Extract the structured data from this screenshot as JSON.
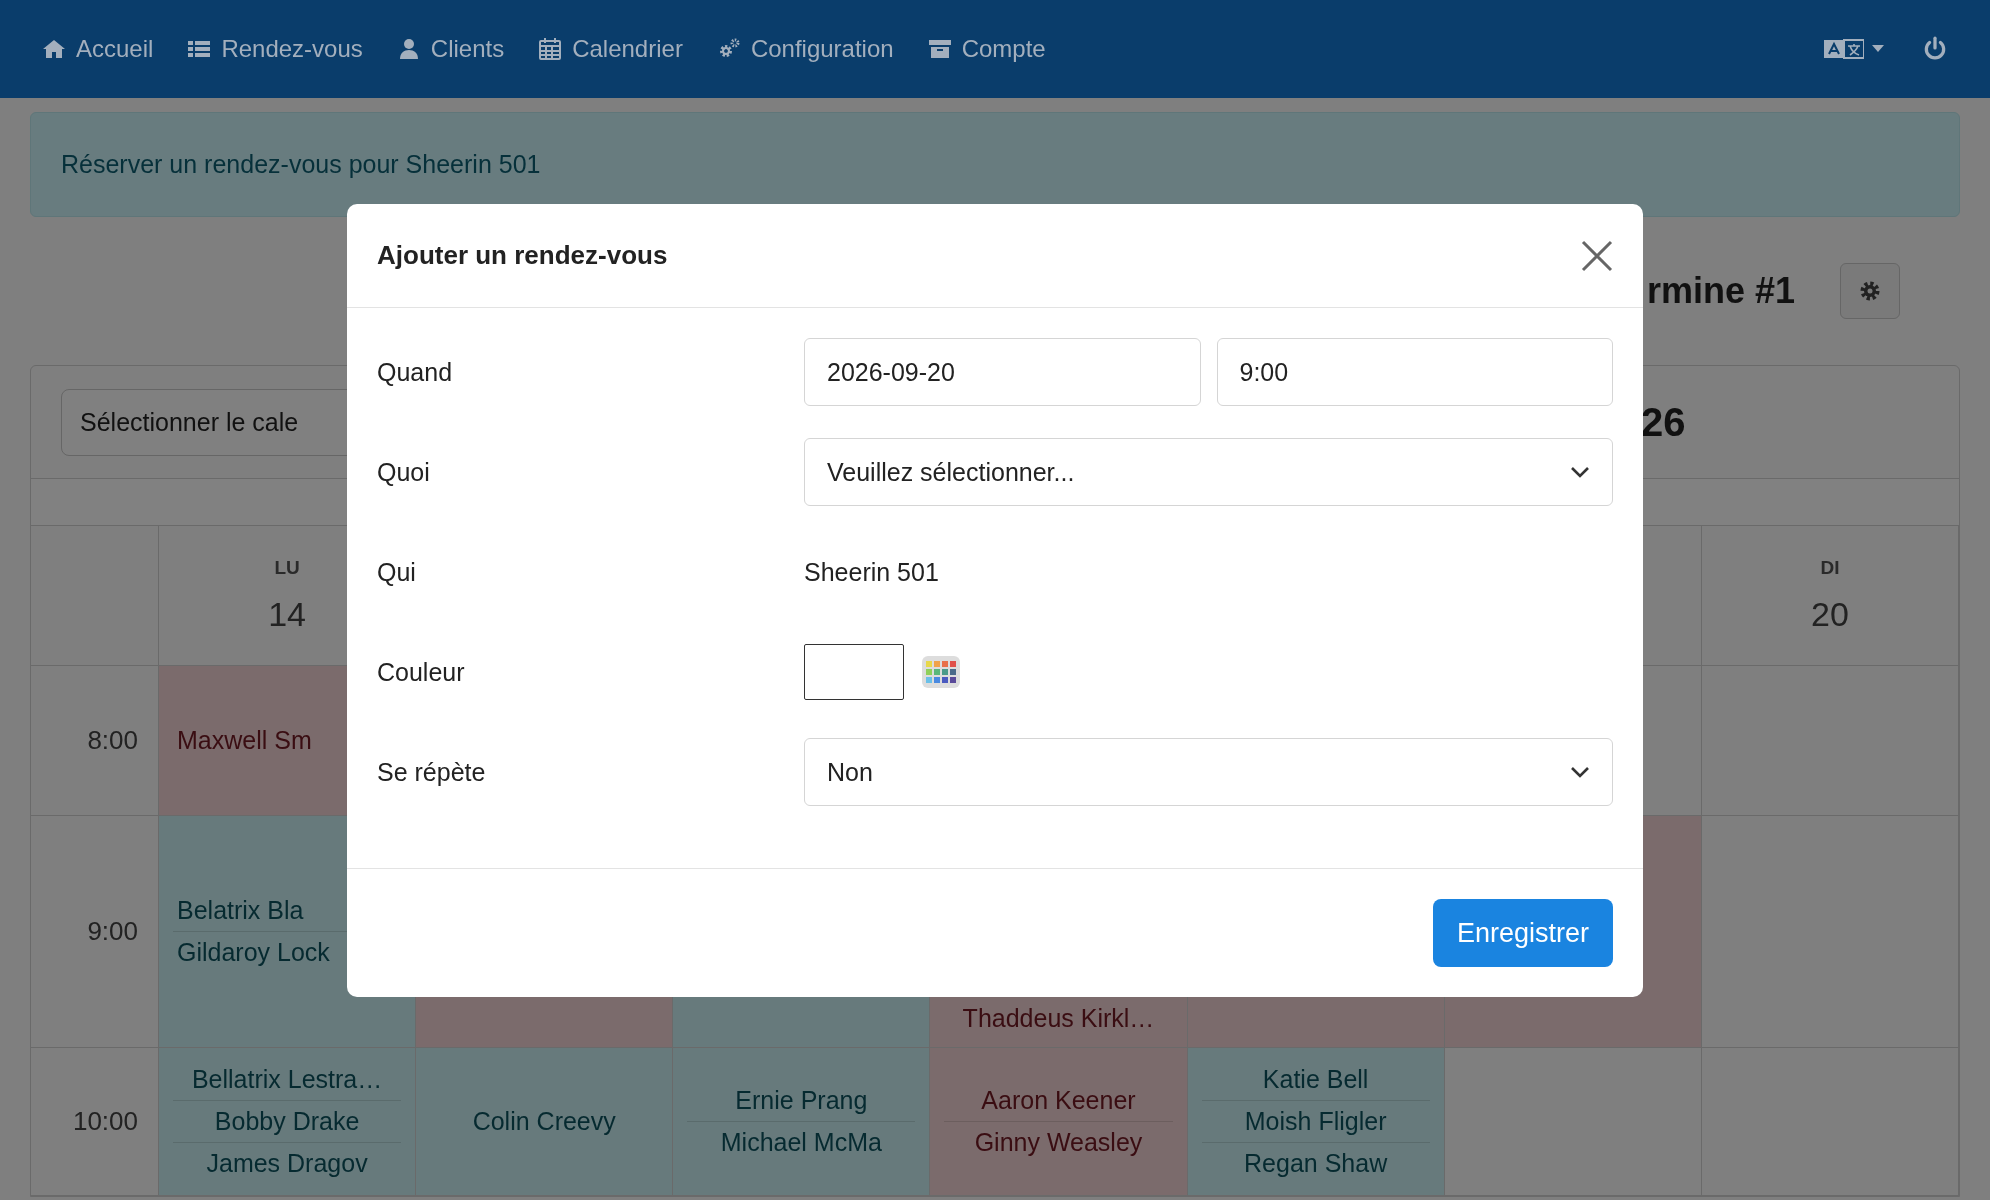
{
  "nav": {
    "items": [
      "Accueil",
      "Rendez-vous",
      "Clients",
      "Calendrier",
      "Configuration",
      "Compte"
    ]
  },
  "alert": {
    "text": "Réserver un rendez-vous pour Sheerin 501"
  },
  "calendar": {
    "heading": "rmine #1",
    "select_button": "Sélectionner le cale",
    "period": "26",
    "days": [
      {
        "abbr": "LU",
        "date": "14"
      },
      {
        "abbr": "DI",
        "date": "20"
      }
    ],
    "rows": [
      {
        "time": "8:00",
        "cells": [
          {
            "color": "#7b6b6c",
            "names": [
              "Maxwell Sm"
            ]
          },
          {},
          {},
          {},
          {},
          {
            "color": "#7f7f7f"
          },
          {
            "color": "#7f7f7f"
          }
        ]
      },
      {
        "time": "9:00",
        "cells": [
          {
            "color": "#677a7c",
            "names": [
              "Belatrix Bla",
              "Gildaroy Lock"
            ]
          },
          {
            "color": "#7b6b6c"
          },
          {
            "color": "#677a7c"
          },
          {
            "color": "#7b6b6c",
            "names": [
              "Thaddeus Kirkl…"
            ]
          },
          {
            "color": "#7b6b6c"
          },
          {
            "color": "#7b6b6c"
          },
          {
            "color": "#7f7f7f"
          }
        ]
      },
      {
        "time": "10:00",
        "cells": [
          {
            "color": "#677a7c",
            "names": [
              "Bellatrix Lestra…",
              "Bobby Drake",
              "James Dragov"
            ]
          },
          {
            "color": "#677a7c",
            "names": [
              "Colin Creevy"
            ]
          },
          {
            "color": "#677a7c",
            "names": [
              "Ernie Prang",
              "Michael McMa"
            ]
          },
          {
            "color": "#7b6b6c",
            "names": [
              "Aaron Keener",
              "Ginny Weasley"
            ]
          },
          {
            "color": "#677a7c",
            "names": [
              "Katie Bell",
              "Moish Fligler",
              "Regan Shaw"
            ]
          },
          {
            "color": "#7f7f7f"
          },
          {
            "color": "#7f7f7f"
          }
        ]
      }
    ]
  },
  "modal": {
    "title": "Ajouter un rendez-vous",
    "fields": [
      {
        "kind": "datetime",
        "label": "Quand",
        "date": "2026-09-20",
        "time": "9:00"
      },
      {
        "kind": "select",
        "label": "Quoi",
        "value": "Veuillez sélectionner..."
      },
      {
        "kind": "text",
        "label": "Qui",
        "value": "Sheerin 501"
      },
      {
        "kind": "color",
        "label": "Couleur",
        "color": "#ffffff"
      },
      {
        "kind": "select",
        "label": "Se répète",
        "value": "Non"
      }
    ],
    "save_button": "Enregistrer"
  }
}
